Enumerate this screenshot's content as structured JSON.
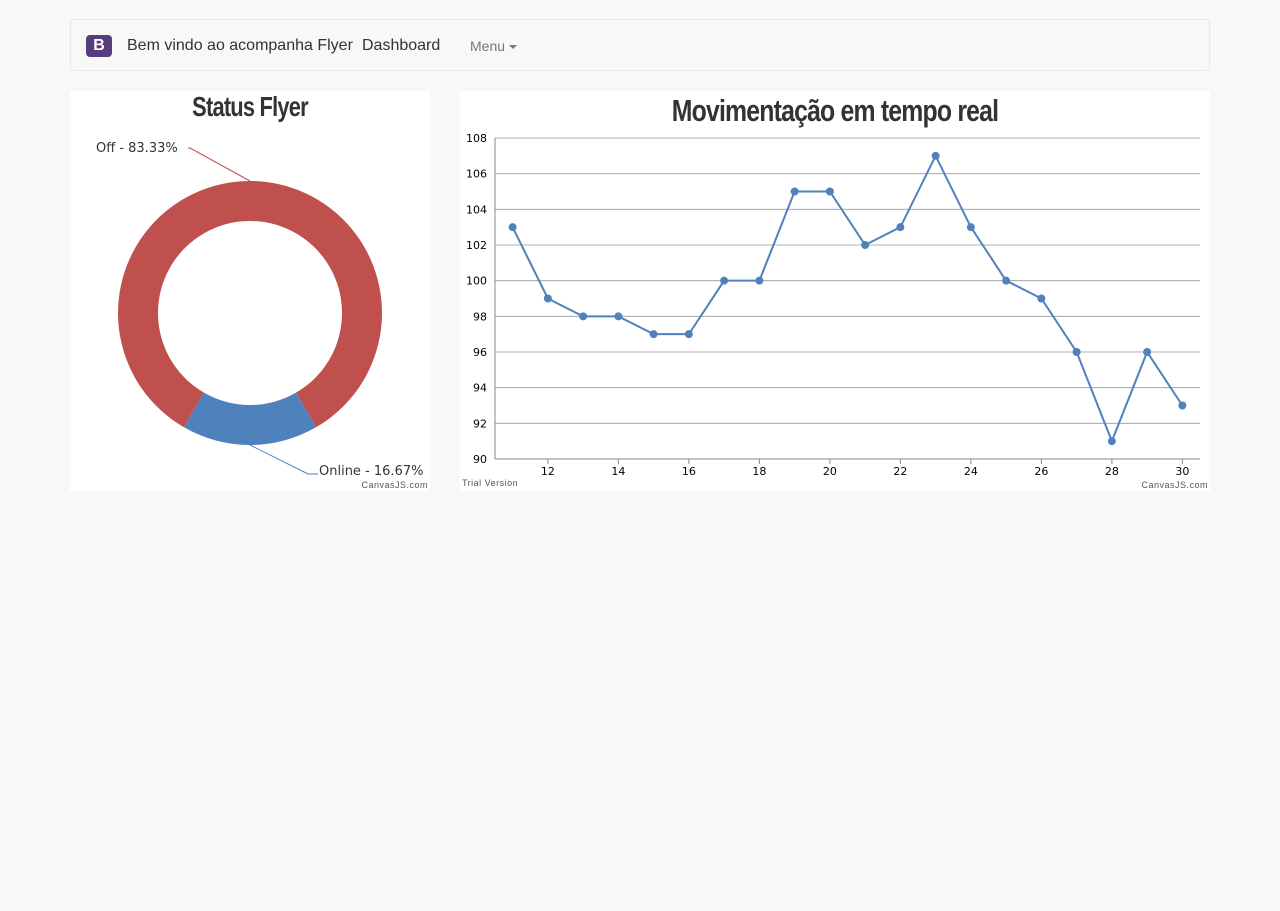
{
  "navbar": {
    "brand_logo": "B",
    "brand_text": "Bem vindo ao acompanha Flyer",
    "dashboard_label": "Dashboard",
    "menu_label": "Menu",
    "caret_icon": "caret-down-icon"
  },
  "credits": {
    "canvasjs": "CanvasJS.com",
    "trial": "Trial Version"
  },
  "chart_data": [
    {
      "type": "pie",
      "title": "Status Flyer",
      "labels": [
        "Off - 83.33%",
        "Online - 16.67%"
      ],
      "values": [
        83.33,
        16.67
      ],
      "colors": [
        "#c0504e",
        "#4f81bc"
      ],
      "donut": true
    },
    {
      "type": "line",
      "title": "Movimentação em tempo real",
      "x": [
        11,
        12,
        13,
        14,
        15,
        16,
        17,
        18,
        19,
        20,
        21,
        22,
        23,
        24,
        25,
        26,
        27,
        28,
        29,
        30
      ],
      "series": [
        {
          "values": [
            103,
            99,
            98,
            98,
            97,
            97,
            100,
            100,
            105,
            105,
            102,
            103,
            107,
            103,
            100,
            99,
            96,
            91,
            96,
            93
          ],
          "color": "#4f81bc"
        }
      ],
      "ylim": [
        90,
        108
      ],
      "yticks": [
        90,
        92,
        94,
        96,
        98,
        100,
        102,
        104,
        106,
        108
      ],
      "xticks": [
        12,
        14,
        16,
        18,
        20,
        22,
        24,
        26,
        28,
        30
      ],
      "grid": true
    }
  ]
}
